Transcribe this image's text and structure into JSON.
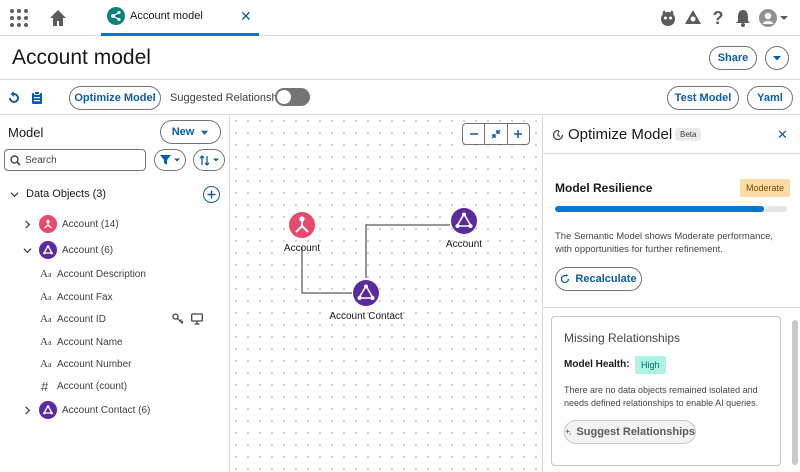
{
  "topbar": {
    "tab_label": "Account model",
    "tab_close": "✕",
    "icons": [
      "app-launcher-icon",
      "home-icon",
      "einstein-icon",
      "trailhead-icon",
      "help-icon",
      "notifications-icon",
      "avatar-icon"
    ]
  },
  "header": {
    "title": "Account model",
    "share_label": "Share"
  },
  "toolbar": {
    "optimize_label": "Optimize Model",
    "suggested_label": "Suggested Relationships",
    "suggested_enabled": false,
    "test_label": "Test Model",
    "yaml_label": "Yaml"
  },
  "left_panel": {
    "title": "Model",
    "new_label": "New",
    "search_placeholder": "Search",
    "section_label": "Data Objects (3)",
    "objects": [
      {
        "label": "Account (14)",
        "color": "#e8496f",
        "expanded": false
      },
      {
        "label": "Account (6)",
        "color": "#5b2b9e",
        "expanded": true
      },
      {
        "label": "Account Contact (6)",
        "color": "#5b2b9e",
        "expanded": false
      }
    ],
    "fields": [
      {
        "label": "Account Description",
        "type": "text"
      },
      {
        "label": "Account Fax",
        "type": "text"
      },
      {
        "label": "Account ID",
        "type": "text"
      },
      {
        "label": "Account Name",
        "type": "text"
      },
      {
        "label": "Account Number",
        "type": "text"
      },
      {
        "label": "Account (count)",
        "type": "number"
      }
    ]
  },
  "canvas": {
    "nodes": [
      {
        "label": "Account",
        "color": "#e8496f"
      },
      {
        "label": "Account",
        "color": "#5b2b9e"
      },
      {
        "label": "Account Contact",
        "color": "#5b2b9e"
      }
    ]
  },
  "right_panel": {
    "title": "Optimize Model",
    "beta": "Beta",
    "close": "✕",
    "resilience_title": "Model Resilience",
    "resilience_status": "Moderate",
    "resilience_progress": 0.9,
    "resilience_desc": "The Semantic Model shows Moderate performance, with opportunities for further refinement.",
    "recalculate_label": "Recalculate",
    "missing_title": "Missing Relationships",
    "health_label": "Model Health:",
    "health_status": "High",
    "missing_desc": "There are no data objects remained isolated and needs defined relationships to enable AI queries.",
    "suggest_label": "Suggest Relationships"
  },
  "colors": {
    "brand": "#0b5cab",
    "accent": "#0176d3",
    "pink_node": "#e8496f",
    "purple_node": "#5b2b9e"
  }
}
